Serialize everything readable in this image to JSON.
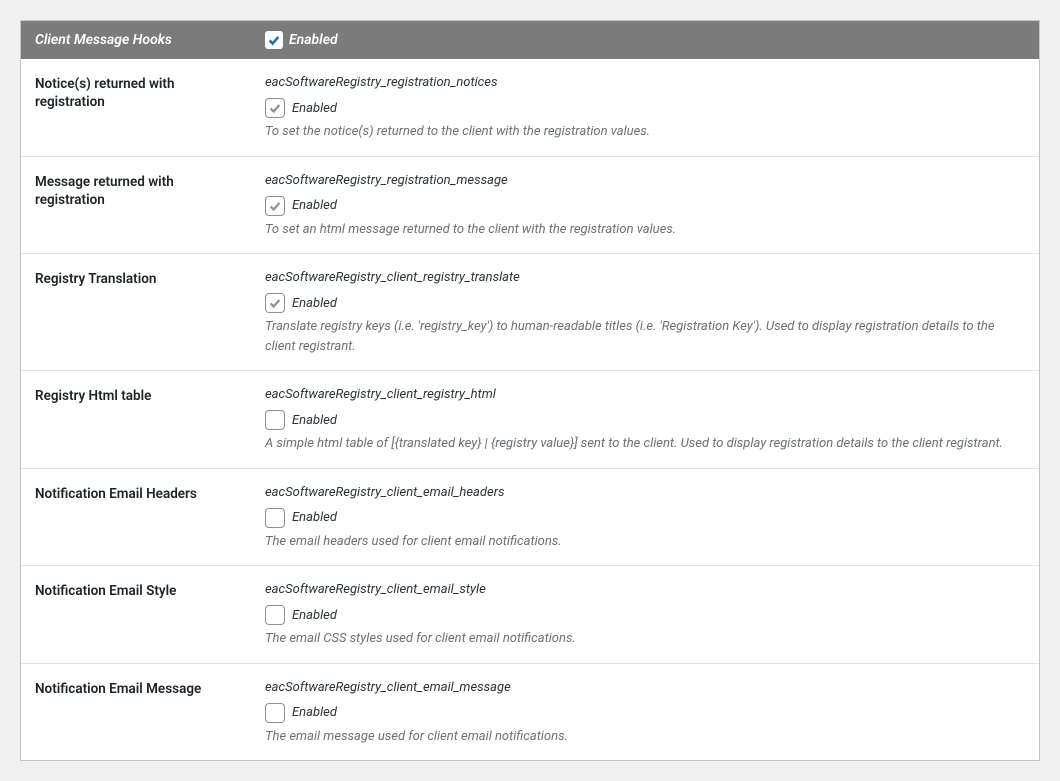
{
  "section": {
    "title": "Client Message Hooks",
    "enabled_label": "Enabled",
    "enabled": true
  },
  "enabled_label": "Enabled",
  "rows": [
    {
      "label": "Notice(s) returned with registration",
      "key": "eacSoftwareRegistry_registration_notices",
      "enabled": true,
      "desc": "To set the notice(s) returned to the client with the registration values."
    },
    {
      "label": "Message returned with registration",
      "key": "eacSoftwareRegistry_registration_message",
      "enabled": true,
      "desc": "To set an html message returned to the client with the registration values."
    },
    {
      "label": "Registry Translation",
      "key": "eacSoftwareRegistry_client_registry_translate",
      "enabled": true,
      "desc": "Translate registry keys (i.e. 'registry_key') to human-readable titles (i.e. 'Registration Key'). Used to display registration details to the client registrant."
    },
    {
      "label": "Registry Html table",
      "key": "eacSoftwareRegistry_client_registry_html",
      "enabled": false,
      "desc": "A simple html table of [{translated key} | {registry value}] sent to the client. Used to display registration details to the client registrant."
    },
    {
      "label": "Notification Email Headers",
      "key": "eacSoftwareRegistry_client_email_headers",
      "enabled": false,
      "desc": "The email headers used for client email notifications."
    },
    {
      "label": "Notification Email Style",
      "key": "eacSoftwareRegistry_client_email_style",
      "enabled": false,
      "desc": "The email CSS styles used for client email notifications."
    },
    {
      "label": "Notification Email Message",
      "key": "eacSoftwareRegistry_client_email_message",
      "enabled": false,
      "desc": "The email message used for client email notifications."
    }
  ]
}
